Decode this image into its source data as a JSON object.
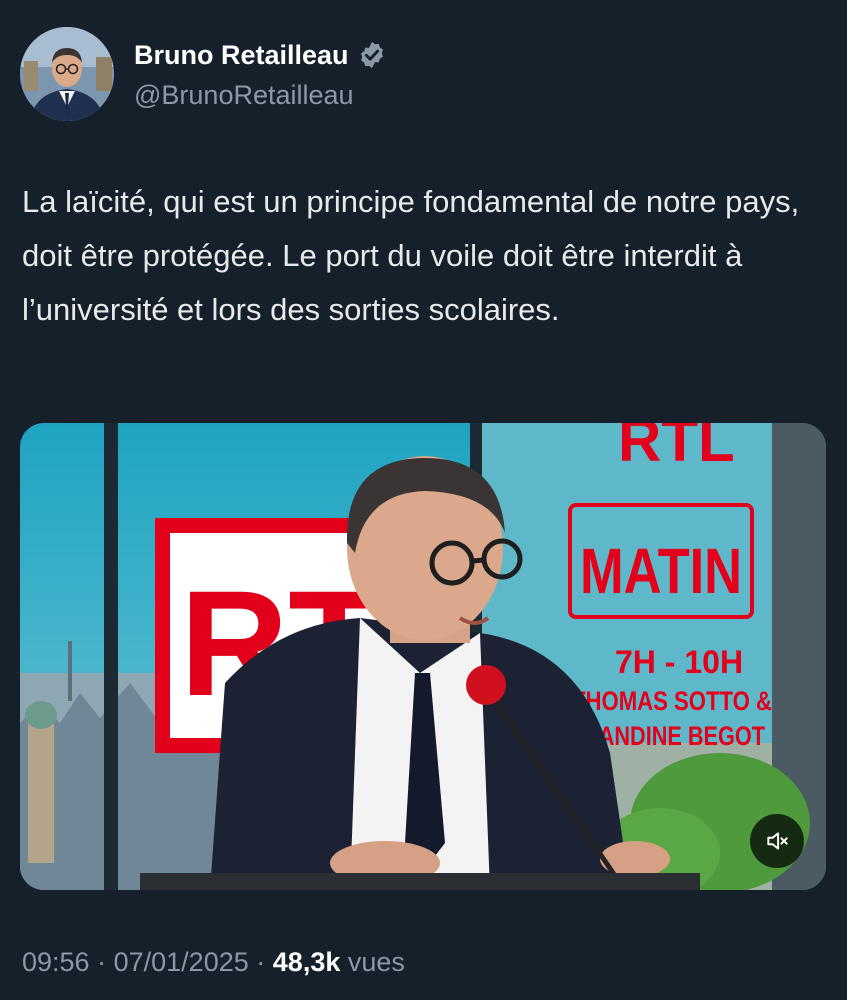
{
  "author": {
    "display_name": "Bruno Retailleau",
    "handle": "@BrunoRetailleau",
    "verified": true,
    "avatar_icon": "profile-photo"
  },
  "tweet": {
    "text": "La laïcité, qui est un principe fondamental de notre pays, doit être protégée. Le port du voile doit être interdit à l’université et lors des sorties scolaires."
  },
  "media": {
    "type": "video",
    "muted": true,
    "overlay": {
      "rtl_logo": "RTL",
      "show_brand": "RTL",
      "show_name": "MATIN",
      "time": "7H - 10H",
      "host1": "THOMAS SOTTO &",
      "host2": "AMANDINE BEGOT"
    },
    "mute_icon": "speaker-muted-icon"
  },
  "meta": {
    "time": "09:56",
    "sep1": "·",
    "date": "07/01/2025",
    "sep2": "·",
    "views_count": "48,3k",
    "views_label": "vues"
  },
  "colors": {
    "background": "#15202b",
    "text": "#e7e9ea",
    "secondary": "#8b98a5",
    "rtl_red": "#e2001a"
  }
}
